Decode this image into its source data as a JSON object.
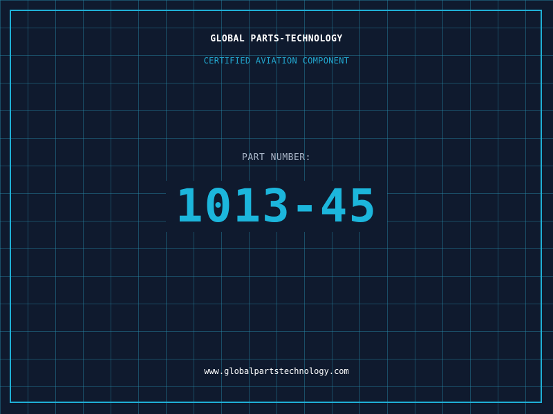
{
  "header": {
    "company_name": "GLOBAL PARTS-TECHNOLOGY",
    "subtitle": "CERTIFIED AVIATION COMPONENT"
  },
  "part": {
    "label": "PART NUMBER:",
    "number": "1013-45"
  },
  "footer": {
    "url": "www.globalpartstechnology.com"
  },
  "colors": {
    "background": "#0f1a2e",
    "grid": "#288caa",
    "frame": "#1fb0d6",
    "accent": "#1cb6dc",
    "label": "#aab6c8"
  }
}
